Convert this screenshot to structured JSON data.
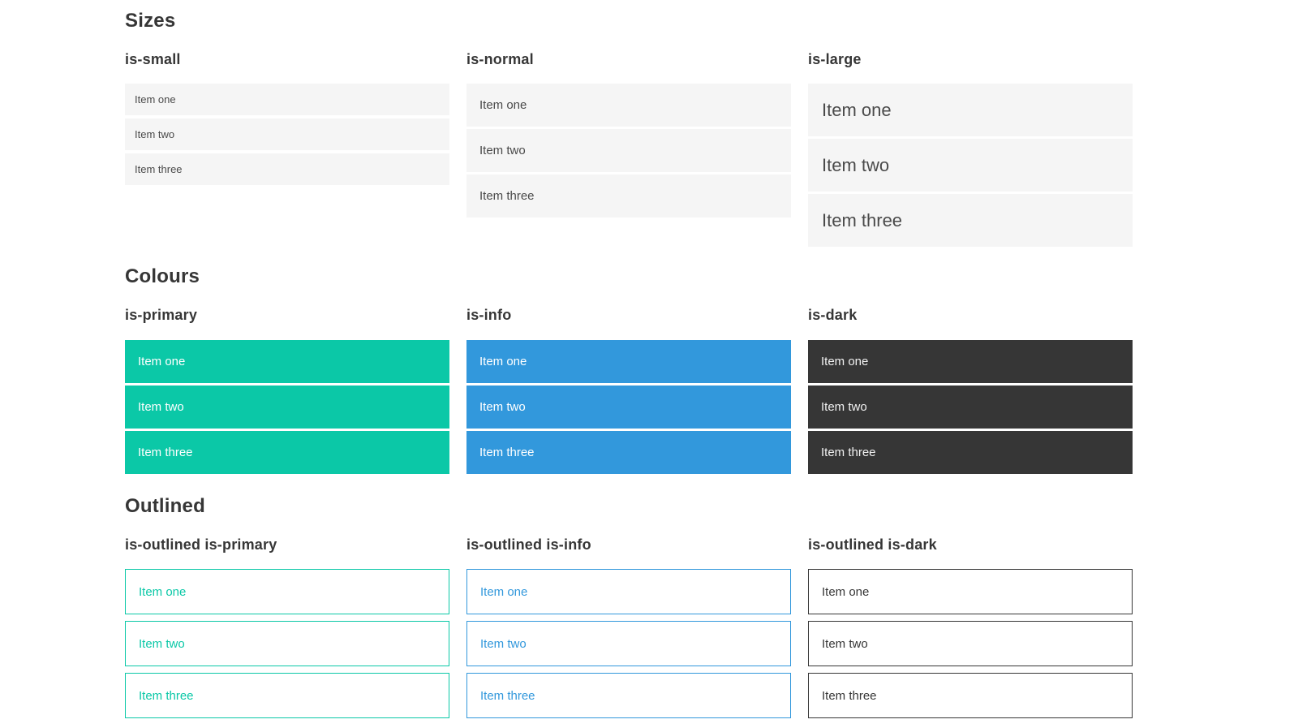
{
  "colors": {
    "primary": "#0bc8a7",
    "info": "#3298dc",
    "dark": "#363636",
    "light_bg": "#f5f5f5",
    "item_text": "#4a4a4a",
    "heading_text": "#363636",
    "on_primary_text": "#ffffff",
    "on_dark_text": "#f2f2f2"
  },
  "sections": [
    {
      "id": "sizes",
      "title": "Sizes",
      "groups": [
        {
          "caption": "is-small",
          "items": [
            "Item one",
            "Item two",
            "Item three"
          ]
        },
        {
          "caption": "is-normal",
          "items": [
            "Item one",
            "Item two",
            "Item three"
          ]
        },
        {
          "caption": "is-large",
          "items": [
            "Item one",
            "Item two",
            "Item three"
          ]
        }
      ]
    },
    {
      "id": "colours",
      "title": "Colours",
      "groups": [
        {
          "caption": "is-primary",
          "items": [
            "Item one",
            "Item two",
            "Item three"
          ]
        },
        {
          "caption": "is-info",
          "items": [
            "Item one",
            "Item two",
            "Item three"
          ]
        },
        {
          "caption": "is-dark",
          "items": [
            "Item one",
            "Item two",
            "Item three"
          ]
        }
      ]
    },
    {
      "id": "outlined",
      "title": "Outlined",
      "groups": [
        {
          "caption": "is-outlined is-primary",
          "items": [
            "Item one",
            "Item two",
            "Item three"
          ]
        },
        {
          "caption": "is-outlined is-info",
          "items": [
            "Item one",
            "Item two",
            "Item three"
          ]
        },
        {
          "caption": "is-outlined is-dark",
          "items": [
            "Item one",
            "Item two",
            "Item three"
          ]
        }
      ]
    }
  ]
}
